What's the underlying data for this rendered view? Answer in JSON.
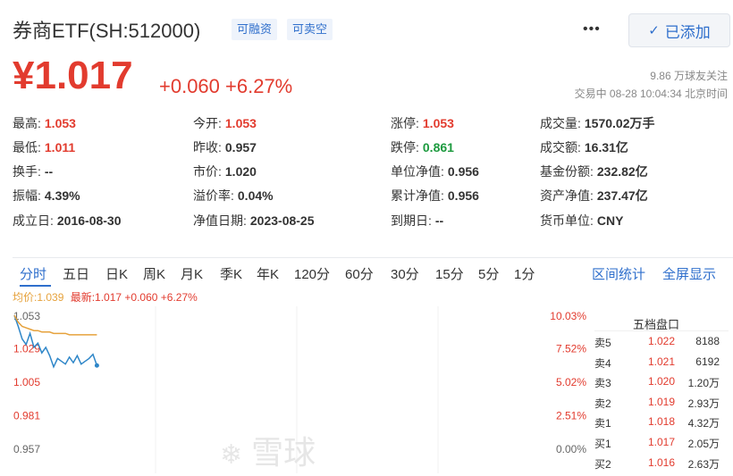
{
  "header": {
    "title": "券商ETF(SH:512000)",
    "tags": [
      "可融资",
      "可卖空"
    ],
    "more_label": "•••",
    "added_label": "已添加",
    "price": "¥1.017",
    "change": "+0.060 +6.27%",
    "followers": "9.86 万球友关注",
    "status": "交易中 08-28 10:04:34 北京时间"
  },
  "stats": [
    [
      {
        "k": "最高:",
        "v": "1.053",
        "c": "up"
      },
      {
        "k": "今开:",
        "v": "1.053",
        "c": "up"
      },
      {
        "k": "涨停:",
        "v": "1.053",
        "c": "up"
      },
      {
        "k": "成交量:",
        "v": "1570.02万手",
        "c": ""
      }
    ],
    [
      {
        "k": "最低:",
        "v": "1.011",
        "c": "up"
      },
      {
        "k": "昨收:",
        "v": "0.957",
        "c": ""
      },
      {
        "k": "跌停:",
        "v": "0.861",
        "c": "down"
      },
      {
        "k": "成交额:",
        "v": "16.31亿",
        "c": ""
      }
    ],
    [
      {
        "k": "换手:",
        "v": "--",
        "c": ""
      },
      {
        "k": "市价:",
        "v": "1.020",
        "c": ""
      },
      {
        "k": "单位净值:",
        "v": "0.956",
        "c": ""
      },
      {
        "k": "基金份额:",
        "v": "232.82亿",
        "c": ""
      }
    ],
    [
      {
        "k": "振幅:",
        "v": "4.39%",
        "c": ""
      },
      {
        "k": "溢价率:",
        "v": "0.04%",
        "c": ""
      },
      {
        "k": "累计净值:",
        "v": "0.956",
        "c": ""
      },
      {
        "k": "资产净值:",
        "v": "237.47亿",
        "c": ""
      }
    ],
    [
      {
        "k": "成立日:",
        "v": "2016-08-30",
        "c": ""
      },
      {
        "k": "净值日期:",
        "v": "2023-08-25",
        "c": ""
      },
      {
        "k": "到期日:",
        "v": "--",
        "c": ""
      },
      {
        "k": "货币单位:",
        "v": "CNY",
        "c": ""
      }
    ]
  ],
  "tabs": [
    "分时",
    "五日",
    "日K",
    "周K",
    "月K",
    "季K",
    "年K",
    "120分",
    "60分",
    "30分",
    "15分",
    "5分",
    "1分"
  ],
  "tab_right": [
    "区间统计",
    "全屏显示"
  ],
  "legend": {
    "avg": "均价:1.039",
    "latest": "最新:1.017 +0.060 +6.27%"
  },
  "chart_data": {
    "type": "line",
    "y_left_ticks": [
      "1.053",
      "1.029",
      "1.005",
      "0.981",
      "0.957"
    ],
    "y_right_ticks": [
      "10.03%",
      "7.52%",
      "5.02%",
      "2.51%",
      "0.00%"
    ],
    "ylim": [
      0.957,
      1.053
    ],
    "series": [
      {
        "values": [
          1.053,
          1.045,
          1.036,
          1.032,
          1.04,
          1.03,
          1.033,
          1.026,
          1.03,
          1.024,
          1.016,
          1.022,
          1.02,
          1.018,
          1.023,
          1.019,
          1.024,
          1.018,
          1.02,
          1.022,
          1.025,
          1.017
        ],
        "color": "#2e86c8"
      },
      {
        "values": [
          1.053,
          1.048,
          1.045,
          1.044,
          1.043,
          1.042,
          1.042,
          1.041,
          1.041,
          1.041,
          1.04,
          1.04,
          1.04,
          1.04,
          1.039,
          1.039,
          1.039,
          1.039,
          1.039,
          1.039,
          1.039,
          1.039
        ],
        "color": "#e6a23c"
      }
    ]
  },
  "order_book": {
    "title": "五档盘口",
    "rows": [
      {
        "k": "卖5",
        "p": "1.022",
        "q": "8188"
      },
      {
        "k": "卖4",
        "p": "1.021",
        "q": "6192"
      },
      {
        "k": "卖3",
        "p": "1.020",
        "q": "1.20万"
      },
      {
        "k": "卖2",
        "p": "1.019",
        "q": "2.93万"
      },
      {
        "k": "卖1",
        "p": "1.018",
        "q": "4.32万"
      },
      {
        "k": "买1",
        "p": "1.017",
        "q": "2.05万"
      },
      {
        "k": "买2",
        "p": "1.016",
        "q": "2.63万"
      }
    ]
  },
  "watermark": "雪球"
}
